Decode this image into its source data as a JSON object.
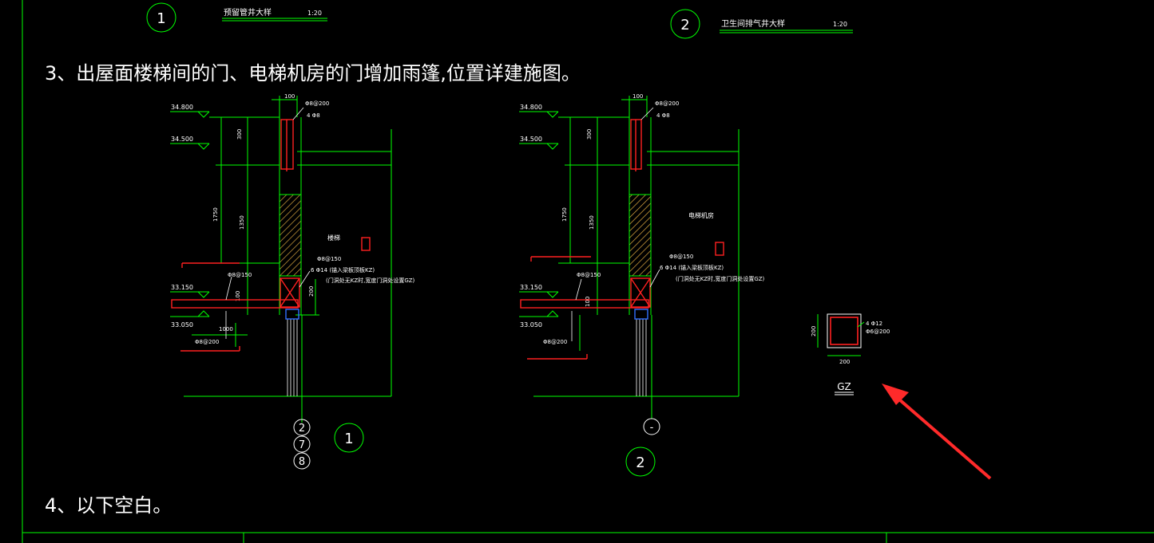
{
  "drawing": {
    "detail1": {
      "number": "1",
      "title": "预留管井大样",
      "scale": "1:20"
    },
    "detail2": {
      "number": "2",
      "title": "卫生间排气井大样",
      "scale": "1:20"
    },
    "notes": {
      "note3": "3、出屋面楼梯间的门、电梯机房的门增加雨篷,位置详建施图。",
      "note4": "4、以下空白。"
    },
    "section1": {
      "elev_top": "34.800",
      "elev_2": "34.500",
      "elev_3": "33.150",
      "elev_4": "33.050",
      "dim_top": "100",
      "dim_300": "300",
      "dim_1750": "1750",
      "dim_1350": "1350",
      "dim_100": "100",
      "dim_1000": "1000",
      "dim_200": "200",
      "rebar_top1": "Φ8@200",
      "rebar_top2": "4 Φ8",
      "rebar_mid": "Φ8@150",
      "rebar_kz1": "6 Φ14 (锚入梁板顶板KZ)",
      "rebar_kz2": "(门洞处无KZ时,宽度门洞处设置GZ)",
      "rebar_stir": "Φ8@150",
      "rebar_bot": "Φ8@200",
      "room": "楼梯",
      "axis_a": "2",
      "axis_b": "7",
      "axis_c": "8",
      "id": "1"
    },
    "section2": {
      "elev_top": "34.800",
      "elev_2": "34.500",
      "elev_3": "33.150",
      "elev_4": "33.050",
      "dim_top": "100",
      "dim_300": "300",
      "dim_1750": "1750",
      "dim_1350": "1350",
      "dim_100": "100",
      "rebar_top1": "Φ8@200",
      "rebar_top2": "4 Φ8",
      "rebar_mid": "Φ8@150",
      "rebar_kz1": "6 Φ14 (锚入梁板顶板KZ)",
      "rebar_kz2": "(门洞处无KZ时,宽度门洞处设置GZ)",
      "rebar_stir": "Φ8@150",
      "rebar_bot": "Φ8@200",
      "room": "电梯机房",
      "axis_a": "-",
      "id": "2"
    },
    "gz": {
      "label": "GZ",
      "dim_h": "200",
      "dim_w": "200",
      "rebar1": "4 Φ12",
      "rebar2": "Φ6@200"
    }
  },
  "colors": {
    "background": "#000000",
    "line_green": "#00ff00",
    "rebar_red": "#ff2020",
    "text_white": "#ffffff",
    "hatch_yellow": "#d9a640",
    "blue": "#3070ff",
    "arrow_red": "#ff2a2a"
  }
}
